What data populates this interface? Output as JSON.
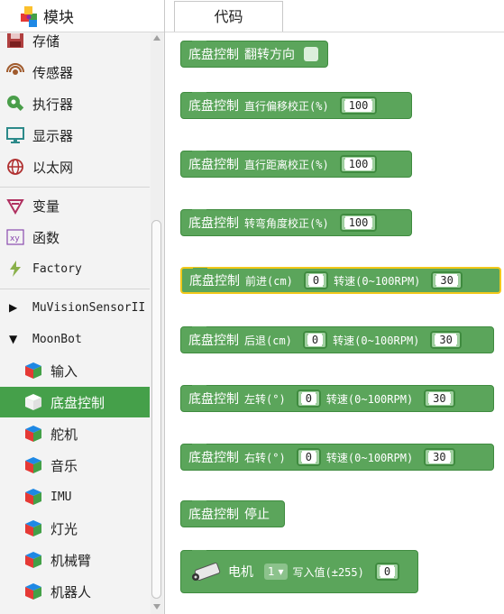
{
  "header": {
    "title": "模块",
    "tab_code": "代码"
  },
  "sidebar": {
    "categories": [
      {
        "label": "存储",
        "icon": "storage-icon"
      },
      {
        "label": "传感器",
        "icon": "sensor-icon"
      },
      {
        "label": "执行器",
        "icon": "actuator-icon"
      },
      {
        "label": "显示器",
        "icon": "display-icon"
      },
      {
        "label": "以太网",
        "icon": "ethernet-icon"
      },
      {
        "label": "变量",
        "icon": "variable-icon"
      },
      {
        "label": "函数",
        "icon": "function-icon"
      },
      {
        "label": "Factory",
        "icon": "factory-icon"
      },
      {
        "label": "MuVisionSensorII",
        "icon": "collapsed-triangle-icon"
      },
      {
        "label": "MoonBot",
        "icon": "expanded-triangle-icon"
      },
      {
        "label": "输入",
        "icon": "cube-icon"
      },
      {
        "label": "底盘控制",
        "icon": "cube-icon",
        "selected": true
      },
      {
        "label": "舵机",
        "icon": "cube-icon"
      },
      {
        "label": "音乐",
        "icon": "cube-icon"
      },
      {
        "label": "IMU",
        "icon": "cube-icon"
      },
      {
        "label": "灯光",
        "icon": "cube-icon"
      },
      {
        "label": "机械臂",
        "icon": "cube-icon"
      },
      {
        "label": "机器人",
        "icon": "cube-icon"
      }
    ]
  },
  "blocks": {
    "b1": {
      "prefix": "底盘控制",
      "text": "翻转方向"
    },
    "b2": {
      "prefix": "底盘控制",
      "text": "直行偏移校正(%)",
      "value": "100"
    },
    "b3": {
      "prefix": "底盘控制",
      "text": "直行距离校正(%)",
      "value": "100"
    },
    "b4": {
      "prefix": "底盘控制",
      "text": "转弯角度校正(%)",
      "value": "100"
    },
    "b5": {
      "prefix": "底盘控制",
      "text": "前进(cm)",
      "value": "0",
      "speed_label": "转速(0~100RPM)",
      "speed": "30"
    },
    "b6": {
      "prefix": "底盘控制",
      "text": "后退(cm)",
      "value": "0",
      "speed_label": "转速(0~100RPM)",
      "speed": "30"
    },
    "b7": {
      "prefix": "底盘控制",
      "text": "左转(°)",
      "value": "0",
      "speed_label": "转速(0~100RPM)",
      "speed": "30"
    },
    "b8": {
      "prefix": "底盘控制",
      "text": "右转(°)",
      "value": "0",
      "speed_label": "转速(0~100RPM)",
      "speed": "30"
    },
    "b9": {
      "prefix": "底盘控制",
      "text": "停止"
    },
    "b10": {
      "label": "电机",
      "dropdown": "1",
      "write_label": "写入值(±255)",
      "value": "0"
    }
  },
  "colors": {
    "block_green": "#5ba55b",
    "selected_outline": "#f2c81a",
    "selected_category": "#45a04a"
  }
}
